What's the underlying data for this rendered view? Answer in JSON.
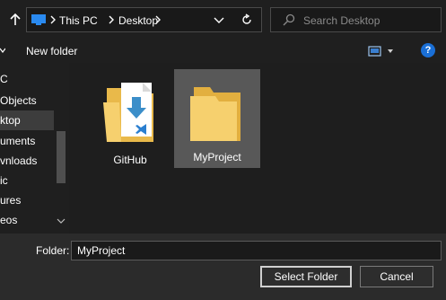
{
  "address": {
    "crumbs": [
      "This PC",
      "Desktop"
    ]
  },
  "search": {
    "placeholder": "Search Desktop"
  },
  "toolbar": {
    "new_folder_label": "New folder",
    "help_label": "?"
  },
  "nav": {
    "items": [
      {
        "label": "C",
        "selected": false
      },
      {
        "label": "Objects",
        "selected": false
      },
      {
        "label": "ktop",
        "selected": true
      },
      {
        "label": "uments",
        "selected": false
      },
      {
        "label": "vnloads",
        "selected": false
      },
      {
        "label": "ic",
        "selected": false
      },
      {
        "label": "ures",
        "selected": false
      },
      {
        "label": "eos",
        "selected": false
      }
    ]
  },
  "files": [
    {
      "name": "GitHub",
      "icon": "vscode-folder-icon",
      "selected": false
    },
    {
      "name": "MyProject",
      "icon": "folder-icon",
      "selected": true
    }
  ],
  "bottom": {
    "folder_label": "Folder:",
    "folder_value": "MyProject",
    "select_button": "Select Folder",
    "cancel_button": "Cancel"
  },
  "colors": {
    "background": "#1f1f1f",
    "accent": "#1a6fd6",
    "folder": "#f4c95d",
    "selection": "#585858"
  }
}
